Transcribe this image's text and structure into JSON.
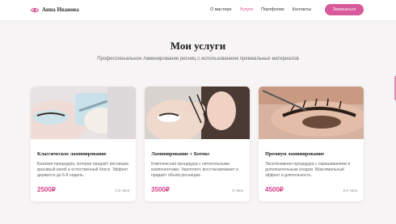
{
  "header": {
    "logo_text": "Анна Иванова",
    "nav": [
      "О мастере",
      "Услуги",
      "Портфолио",
      "Контакты"
    ],
    "active_nav": "Услуги",
    "cta_label": "Записаться"
  },
  "section": {
    "title": "Мои услуги",
    "subtitle": "Профессиональное ламинирование ресниц с использованием премиальных материалов"
  },
  "cards": [
    {
      "title": "Классическое ламинирование",
      "description": "Базовая процедура, которая придаёт ресницам красивый изгиб и естественный блеск. Эффект держится до 6-8 недель.",
      "price": "2500₽",
      "duration": "1.5 часа"
    },
    {
      "title": "Ламинирование + Ботокс",
      "description": "Комплексная процедура с питательными компонентами. Укрепляет, восстанавливает и придаёт объём ресницам.",
      "price": "3500₽",
      "duration": "2 часа"
    },
    {
      "title": "Премиум ламинирование",
      "description": "Эксклюзивная процедура с окрашиванием и дополнительным уходом. Максимальный эффект и длительность.",
      "price": "4500₽",
      "duration": "2.5 часа"
    }
  ],
  "colors": {
    "accent": "#d6428c",
    "button": "#d85a9c",
    "background": "#f6f4f5"
  },
  "icons": {
    "logo": "eye-icon"
  }
}
